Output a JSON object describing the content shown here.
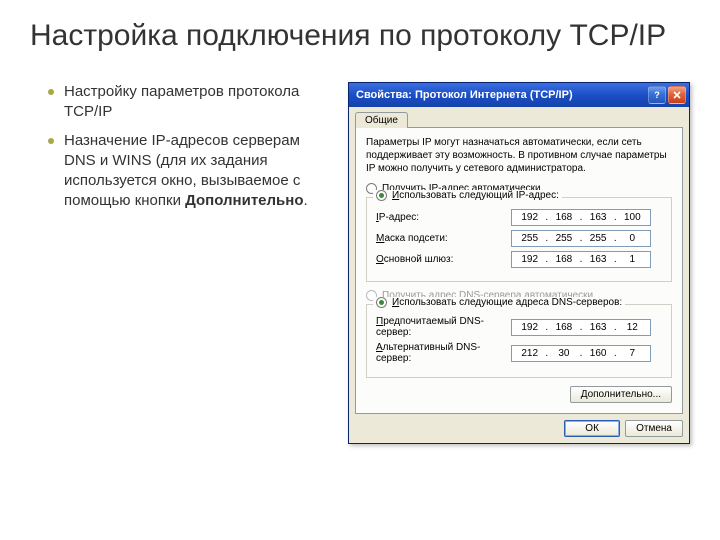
{
  "slide": {
    "title": "Настройка подключения по протоколу TCP/IP",
    "bullets": [
      "Настройку параметров протокола TCP/IP",
      "Назначение IP-адресов серверам DNS и WINS (для их задания используется окно, вызываемое с помощью кнопки "
    ],
    "bullet2_bold": "Дополнительно",
    "bullet2_tail": "."
  },
  "dialog": {
    "title": "Свойства: Протокол Интернета (TCP/IP)",
    "tab": "Общие",
    "description": "Параметры IP могут назначаться автоматически, если сеть поддерживает эту возможность. В противном случае параметры IP можно получить у сетевого администратора.",
    "radio_auto_ip": "Получить IP-адрес автоматически",
    "radio_use_ip": "Использовать следующий IP-адрес:",
    "label_ip": "IP-адрес:",
    "label_mask": "Маска подсети:",
    "label_gateway": "Основной шлюз:",
    "ip": [
      "192",
      "168",
      "163",
      "100"
    ],
    "mask": [
      "255",
      "255",
      "255",
      "0"
    ],
    "gateway": [
      "192",
      "168",
      "163",
      "1"
    ],
    "radio_auto_dns": "Получить адрес DNS-сервера автоматически",
    "radio_use_dns": "Использовать следующие адреса DNS-серверов:",
    "label_dns1": "Предпочитаемый DNS-сервер:",
    "label_dns2": "Альтернативный DNS-сервер:",
    "dns1": [
      "192",
      "168",
      "163",
      "12"
    ],
    "dns2": [
      "212",
      "30",
      "160",
      "7"
    ],
    "btn_advanced": "Дополнительно...",
    "btn_ok": "ОК",
    "btn_cancel": "Отмена"
  }
}
